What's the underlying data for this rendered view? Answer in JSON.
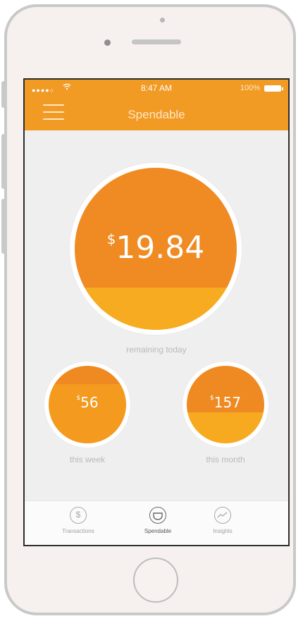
{
  "status_bar": {
    "signal": "●●●●○",
    "time": "8:47 AM",
    "battery": "100%"
  },
  "header": {
    "title": "Spendable"
  },
  "main": {
    "today": {
      "currency": "$",
      "amount": "19.84",
      "label": "remaining today"
    },
    "week": {
      "currency": "$",
      "amount": "56",
      "label": "this week"
    },
    "month": {
      "currency": "$",
      "amount": "157",
      "label": "this month"
    }
  },
  "tabs": [
    {
      "label": "Transactions",
      "icon": "dollar-circle-icon",
      "glyph": "$"
    },
    {
      "label": "Spendable",
      "icon": "spendable-cup-icon",
      "glyph": ""
    },
    {
      "label": "Insights",
      "icon": "trend-line-icon",
      "glyph": ""
    }
  ],
  "colors": {
    "accent": "#f19a24",
    "circle_dark": "#ef8b22",
    "circle_light": "#f6ab20"
  }
}
